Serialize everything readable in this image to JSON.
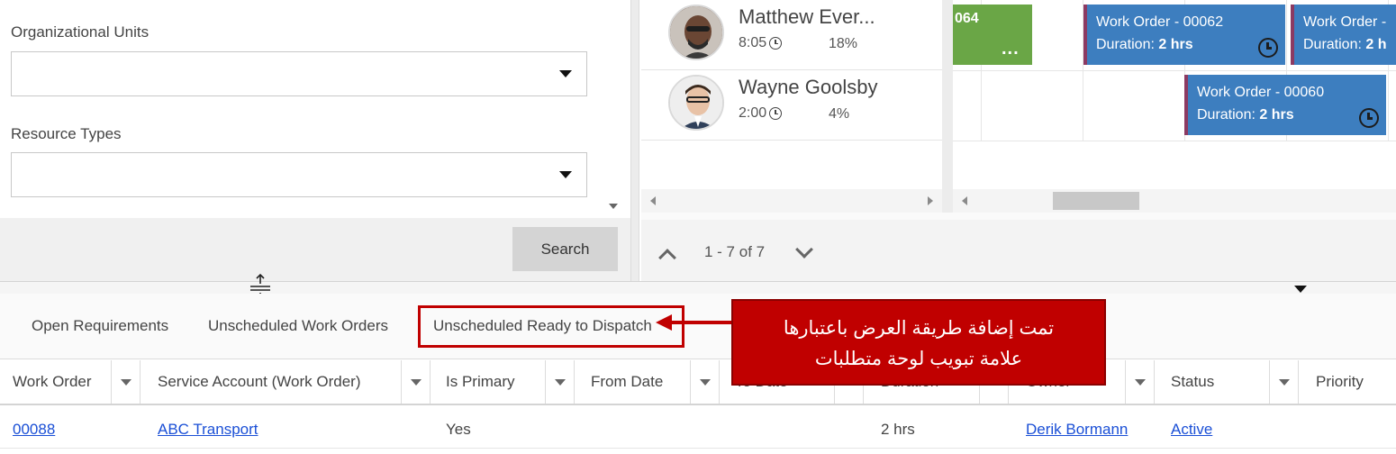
{
  "filters": {
    "org_units_label": "Organizational Units",
    "org_units_value": "",
    "resource_types_label": "Resource Types",
    "resource_types_value": "",
    "search_label": "Search"
  },
  "resources": [
    {
      "name": "Matthew Ever...",
      "time": "8:05",
      "utilization": "18%"
    },
    {
      "name": "Wayne Goolsby",
      "time": "2:00",
      "utilization": "4%"
    }
  ],
  "board": {
    "partial_block_label": "064",
    "partial_block_more": "...",
    "work_orders": [
      {
        "title": "Work Order - 00062",
        "duration_prefix": "Duration:",
        "duration": "2 hrs"
      },
      {
        "title": "Work Order -",
        "duration_prefix": "Duration:",
        "duration": "2 h"
      },
      {
        "title": "Work Order - 00060",
        "duration_prefix": "Duration:",
        "duration": "2 hrs"
      }
    ]
  },
  "pager": {
    "text": "1 - 7 of 7"
  },
  "tabs": [
    {
      "label": "Open Requirements"
    },
    {
      "label": "Unscheduled Work Orders"
    },
    {
      "label": "Unscheduled Ready to Dispatch"
    }
  ],
  "grid": {
    "columns": [
      "Work Order",
      "Service Account (Work Order)",
      "Is Primary",
      "From Date",
      "To Date",
      "Duration",
      "Owner",
      "Status",
      "Priority"
    ],
    "rows": [
      {
        "work_order": "00088",
        "service_account": "ABC Transport",
        "is_primary": "Yes",
        "duration": "2 hrs",
        "owner": "Derik Bormann",
        "status": "Active"
      }
    ]
  },
  "callout": {
    "line1": "تمت إضافة طريقة العرض باعتبارها",
    "line2": "علامة تبويب لوحة متطلبات"
  },
  "colors": {
    "accent_red": "#c00000",
    "work_order_blue": "#3d7ebf",
    "green_block": "#6aa646",
    "link": "#1a4fd6"
  }
}
